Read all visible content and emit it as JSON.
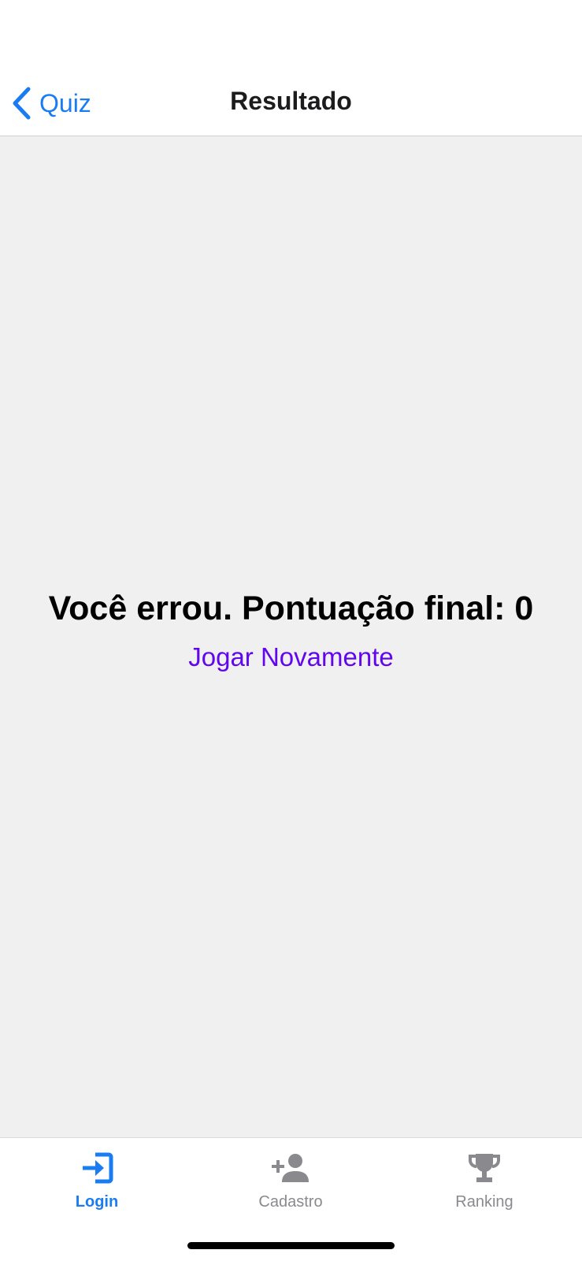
{
  "header": {
    "back_label": "Quiz",
    "back_icon": "chevron-left-icon",
    "title": "Resultado"
  },
  "main": {
    "message": "Você errou. Pontuação final: 0",
    "play_again_label": "Jogar Novamente"
  },
  "tabbar": {
    "tabs": [
      {
        "label": "Login",
        "icon": "login-icon",
        "active": true
      },
      {
        "label": "Cadastro",
        "icon": "add-user-icon",
        "active": false
      },
      {
        "label": "Ranking",
        "icon": "trophy-icon",
        "active": false
      }
    ]
  },
  "colors": {
    "accent": "#1a7cf2",
    "link": "#6206ee",
    "inactive": "#8a8a8e",
    "background": "#f0f0f0"
  }
}
